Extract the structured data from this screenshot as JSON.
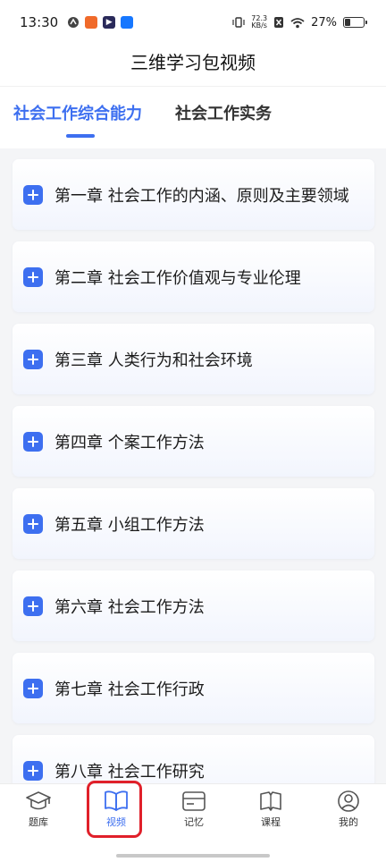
{
  "status_bar": {
    "time": "13:30",
    "net_speed_value": "72.3",
    "net_speed_unit": "KB/s",
    "battery_percent": "27%",
    "battery_level": 0.27
  },
  "header": {
    "title": "三维学习包视频"
  },
  "tabs": [
    {
      "label": "社会工作综合能力",
      "active": true
    },
    {
      "label": "社会工作实务",
      "active": false
    }
  ],
  "chapters": [
    {
      "label": "第一章 社会工作的内涵、原则及主要领域"
    },
    {
      "label": "第二章 社会工作价值观与专业伦理"
    },
    {
      "label": "第三章 人类行为和社会环境"
    },
    {
      "label": "第四章 个案工作方法"
    },
    {
      "label": "第五章 小组工作方法"
    },
    {
      "label": "第六章 社会工作方法"
    },
    {
      "label": "第七章 社会工作行政"
    },
    {
      "label": "第八章 社会工作研究"
    }
  ],
  "bottom_nav": [
    {
      "label": "题库",
      "icon": "graduation-cap-icon"
    },
    {
      "label": "视频",
      "icon": "open-book-icon",
      "active": true
    },
    {
      "label": "记忆",
      "icon": "card-icon"
    },
    {
      "label": "课程",
      "icon": "book-icon"
    },
    {
      "label": "我的",
      "icon": "user-icon"
    }
  ],
  "colors": {
    "accent": "#3d6ff0",
    "highlight_box": "#e0202a",
    "background": "#f4f5f7"
  }
}
